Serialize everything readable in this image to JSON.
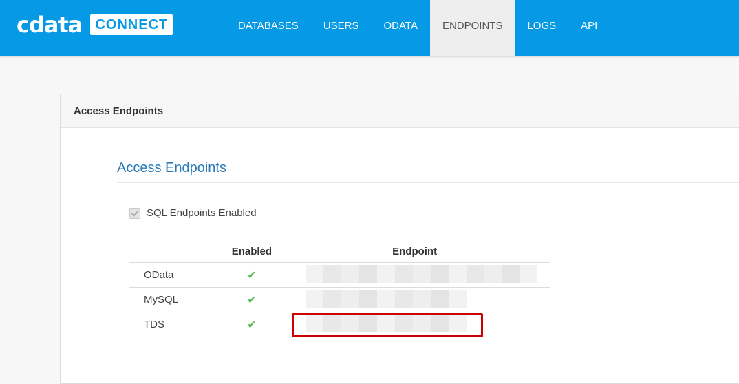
{
  "app": {
    "logo_text": "cdata",
    "product_name": "CONNECT",
    "brand_color": "#069ae6"
  },
  "nav": {
    "items": [
      {
        "label": "DATABASES",
        "active": false
      },
      {
        "label": "USERS",
        "active": false
      },
      {
        "label": "ODATA",
        "active": false
      },
      {
        "label": "ENDPOINTS",
        "active": true
      },
      {
        "label": "LOGS",
        "active": false
      },
      {
        "label": "API",
        "active": false
      }
    ]
  },
  "card": {
    "header": "Access Endpoints",
    "section_title": "Access Endpoints",
    "sql_checkbox": {
      "label": "SQL Endpoints Enabled",
      "checked": true,
      "disabled": true
    }
  },
  "table": {
    "headers": [
      "",
      "Enabled",
      "Endpoint"
    ],
    "rows": [
      {
        "name": "OData",
        "enabled": true,
        "check_icon": "✔",
        "endpoint": "[redacted]"
      },
      {
        "name": "MySQL",
        "enabled": true,
        "check_icon": "✔",
        "endpoint": "[redacted]"
      },
      {
        "name": "TDS",
        "enabled": true,
        "check_icon": "✔",
        "endpoint": "[redacted]"
      }
    ],
    "check_color": "#5cb85c",
    "highlight_color": "#cc0000"
  }
}
